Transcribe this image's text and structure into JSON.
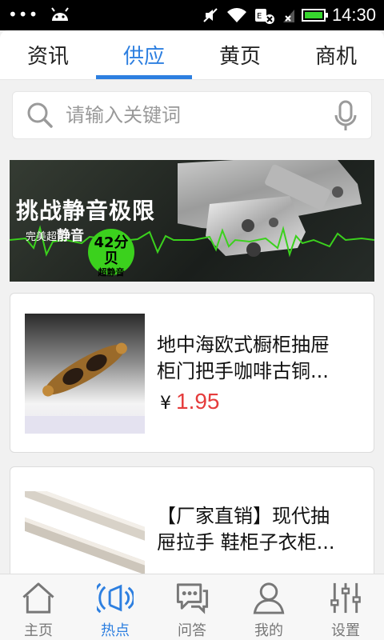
{
  "status_bar": {
    "time": "14:30",
    "battery_level": 1.0,
    "accent": "#37d62e"
  },
  "tabs": [
    {
      "label": "资讯",
      "active": false
    },
    {
      "label": "供应",
      "active": true
    },
    {
      "label": "黄页",
      "active": false
    },
    {
      "label": "商机",
      "active": false
    }
  ],
  "search": {
    "placeholder": "请输入关键词",
    "value": ""
  },
  "banner": {
    "title": "挑战静音极限",
    "subtitle_prefix": "完美超",
    "subtitle_strong": "静音",
    "badge_value": "42分贝",
    "badge_label": "超静音"
  },
  "products": [
    {
      "title": "地中海欧式橱柜抽屉\n柜门把手咖啡古铜...",
      "currency": "¥",
      "price": "1.95"
    },
    {
      "title": "【厂家直销】现代抽\n屉拉手 鞋柜子衣柜..."
    }
  ],
  "bottom_nav": [
    {
      "label": "主页",
      "icon": "home-icon",
      "active": false
    },
    {
      "label": "热点",
      "icon": "broadcast-icon",
      "active": true
    },
    {
      "label": "问答",
      "icon": "chat-bubble-icon",
      "active": false
    },
    {
      "label": "我的",
      "icon": "user-icon",
      "active": false
    },
    {
      "label": "设置",
      "icon": "settings-sliders-icon",
      "active": false
    }
  ],
  "colors": {
    "primary": "#2d7fe0",
    "price": "#e53c3c",
    "badge": "#3bd11d"
  }
}
